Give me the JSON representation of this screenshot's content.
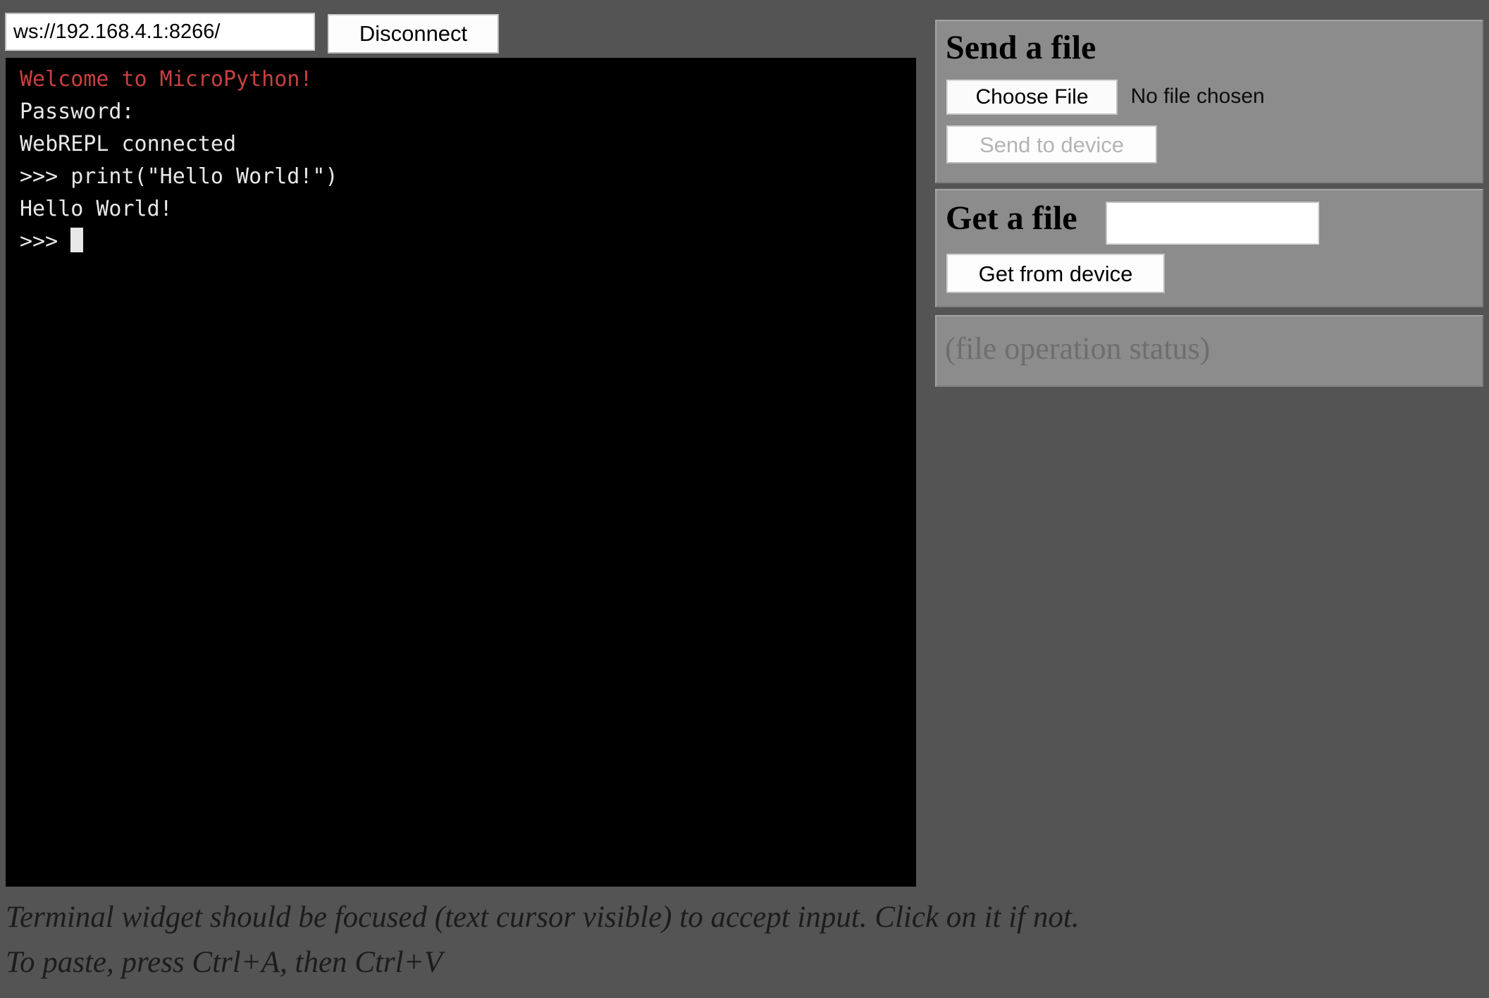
{
  "connection": {
    "url_value": "ws://192.168.4.1:8266/",
    "url_placeholder": "ws://",
    "disconnect_label": "Disconnect"
  },
  "terminal": {
    "lines": [
      {
        "text": "Welcome to MicroPython!",
        "color": "#c84040"
      },
      {
        "text": "Password:",
        "color": "#e8e8e8"
      },
      {
        "text": "WebREPL connected",
        "color": "#e8e8e8"
      },
      {
        "text": ">>> print(\"Hello World!\")",
        "color": "#e8e8e8"
      },
      {
        "text": "Hello World!",
        "color": "#e8e8e8"
      },
      {
        "text": ">>>",
        "color": "#e8e8e8",
        "cursor": true
      }
    ],
    "background": "#000000",
    "foreground": "#e8e8e8"
  },
  "hints": {
    "line1": "Terminal widget should be focused (text cursor visible) to accept input. Click on it if not.",
    "line2": "To paste, press Ctrl+A, then Ctrl+V"
  },
  "send_panel": {
    "title": "Send a file",
    "choose_file_label": "Choose File",
    "file_status": "No file chosen",
    "send_label": "Send to device",
    "send_enabled": false
  },
  "get_panel": {
    "title": "Get a file",
    "filename_value": "",
    "filename_placeholder": "",
    "get_label": "Get from device"
  },
  "status_panel": {
    "text": "(file operation status)"
  },
  "colors": {
    "page_background": "#545454",
    "panel_background": "#8c8c8c",
    "terminal_background": "#000000",
    "welcome_red": "#c84040",
    "disabled_text": "#b4b4b4",
    "status_text": "#6e6e6e"
  }
}
